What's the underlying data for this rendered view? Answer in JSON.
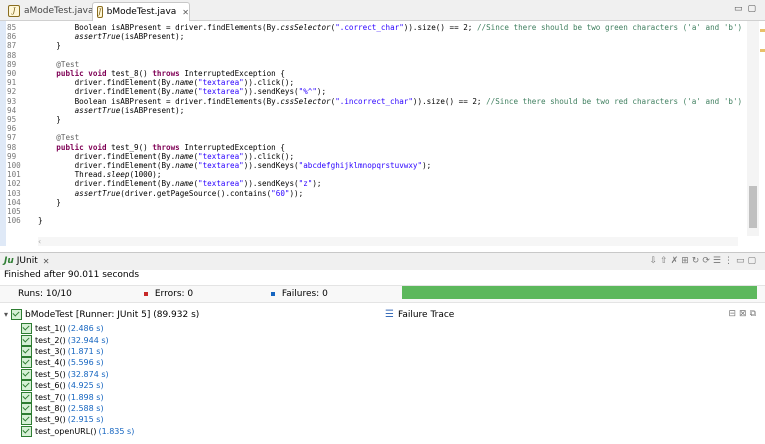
{
  "editor_tabs": [
    {
      "label": "aModeTest.java"
    },
    {
      "label": "bModeTest.java"
    }
  ],
  "code_lines": [
    {
      "num": "85",
      "parts": [
        {
          "t": "        Boolean "
        },
        {
          "t": "isABPresent",
          "c": "plain"
        },
        {
          "t": " = driver.findElements(By."
        },
        {
          "t": "cssSelector",
          "c": "it"
        },
        {
          "t": "("
        },
        {
          "t": "\".correct_char\"",
          "c": "str"
        },
        {
          "t": ")).size() == 2; "
        },
        {
          "t": "//Since there should be two green characters ('a' and 'b')",
          "c": "cm"
        }
      ]
    },
    {
      "num": "86",
      "parts": [
        {
          "t": "        "
        },
        {
          "t": "assertTrue",
          "c": "it"
        },
        {
          "t": "(isABPresent);"
        }
      ]
    },
    {
      "num": "87",
      "parts": [
        {
          "t": "    }"
        }
      ]
    },
    {
      "num": "88",
      "parts": [
        {
          "t": ""
        }
      ]
    },
    {
      "num": "89",
      "parts": [
        {
          "t": "    "
        },
        {
          "t": "@Test",
          "c": "an"
        }
      ]
    },
    {
      "num": "90",
      "parts": [
        {
          "t": "    "
        },
        {
          "t": "public void",
          "c": "kw"
        },
        {
          "t": " test_8() "
        },
        {
          "t": "throws",
          "c": "kw"
        },
        {
          "t": " InterruptedException {"
        }
      ]
    },
    {
      "num": "91",
      "parts": [
        {
          "t": "        driver.findElement(By."
        },
        {
          "t": "name",
          "c": "it"
        },
        {
          "t": "("
        },
        {
          "t": "\"textarea\"",
          "c": "str"
        },
        {
          "t": ")).click();"
        }
      ]
    },
    {
      "num": "92",
      "parts": [
        {
          "t": "        driver.findElement(By."
        },
        {
          "t": "name",
          "c": "it"
        },
        {
          "t": "("
        },
        {
          "t": "\"textarea\"",
          "c": "str"
        },
        {
          "t": ")).sendKeys("
        },
        {
          "t": "\"%^\"",
          "c": "str"
        },
        {
          "t": ");"
        }
      ]
    },
    {
      "num": "93",
      "parts": [
        {
          "t": "        Boolean isABPresent = driver.findElements(By."
        },
        {
          "t": "cssSelector",
          "c": "it"
        },
        {
          "t": "("
        },
        {
          "t": "\".incorrect_char\"",
          "c": "str"
        },
        {
          "t": ")).size() == 2; "
        },
        {
          "t": "//Since there should be two red characters ('a' and 'b')",
          "c": "cm"
        }
      ]
    },
    {
      "num": "94",
      "parts": [
        {
          "t": "        "
        },
        {
          "t": "assertTrue",
          "c": "it"
        },
        {
          "t": "(isABPresent);"
        }
      ]
    },
    {
      "num": "95",
      "parts": [
        {
          "t": "    }"
        }
      ]
    },
    {
      "num": "96",
      "parts": [
        {
          "t": ""
        }
      ]
    },
    {
      "num": "97",
      "parts": [
        {
          "t": "    "
        },
        {
          "t": "@Test",
          "c": "an"
        }
      ]
    },
    {
      "num": "98",
      "parts": [
        {
          "t": "    "
        },
        {
          "t": "public void",
          "c": "kw"
        },
        {
          "t": " test_9() "
        },
        {
          "t": "throws",
          "c": "kw"
        },
        {
          "t": " InterruptedException {"
        }
      ]
    },
    {
      "num": "99",
      "parts": [
        {
          "t": "        driver.findElement(By."
        },
        {
          "t": "name",
          "c": "it"
        },
        {
          "t": "("
        },
        {
          "t": "\"textarea\"",
          "c": "str"
        },
        {
          "t": ")).click();"
        }
      ]
    },
    {
      "num": "100",
      "parts": [
        {
          "t": "        driver.findElement(By."
        },
        {
          "t": "name",
          "c": "it"
        },
        {
          "t": "("
        },
        {
          "t": "\"textarea\"",
          "c": "str"
        },
        {
          "t": ")).sendKeys("
        },
        {
          "t": "\"abcdefghijklmnopqrstuvwxy\"",
          "c": "str"
        },
        {
          "t": ");"
        }
      ]
    },
    {
      "num": "101",
      "parts": [
        {
          "t": "        Thread."
        },
        {
          "t": "sleep",
          "c": "it"
        },
        {
          "t": "(1000);"
        }
      ]
    },
    {
      "num": "102",
      "parts": [
        {
          "t": "        driver.findElement(By."
        },
        {
          "t": "name",
          "c": "it"
        },
        {
          "t": "("
        },
        {
          "t": "\"textarea\"",
          "c": "str"
        },
        {
          "t": ")).sendKeys("
        },
        {
          "t": "\"z\"",
          "c": "str"
        },
        {
          "t": ");"
        }
      ]
    },
    {
      "num": "103",
      "parts": [
        {
          "t": "        "
        },
        {
          "t": "assertTrue",
          "c": "it"
        },
        {
          "t": "(driver.getPageSource().contains("
        },
        {
          "t": "\"60\"",
          "c": "str"
        },
        {
          "t": "));"
        }
      ]
    },
    {
      "num": "104",
      "parts": [
        {
          "t": "    }"
        }
      ]
    },
    {
      "num": "105",
      "parts": [
        {
          "t": ""
        }
      ]
    },
    {
      "num": "106",
      "parts": [
        {
          "t": "}"
        }
      ]
    }
  ],
  "junit": {
    "tab_label": "JUnit",
    "finished_text": "Finished after 90.011 seconds",
    "runs_label": "Runs:",
    "runs_value": "10/10",
    "errors_label": "Errors:",
    "errors_value": "0",
    "failures_label": "Failures:",
    "failures_value": "0",
    "progress_fraction": 1.0,
    "progress_color": "#5cb85c",
    "root_label": "bModeTest [Runner: JUnit 5] (89.932 s)",
    "tests": [
      {
        "name": "test_1()",
        "time": "(2.486 s)"
      },
      {
        "name": "test_2()",
        "time": "(32.944 s)"
      },
      {
        "name": "test_3()",
        "time": "(1.871 s)"
      },
      {
        "name": "test_4()",
        "time": "(5.596 s)"
      },
      {
        "name": "test_5()",
        "time": "(32.874 s)"
      },
      {
        "name": "test_6()",
        "time": "(4.925 s)"
      },
      {
        "name": "test_7()",
        "time": "(1.898 s)"
      },
      {
        "name": "test_8()",
        "time": "(2.588 s)"
      },
      {
        "name": "test_9()",
        "time": "(2.915 s)"
      },
      {
        "name": "test_openURL()",
        "time": "(1.835 s)"
      }
    ],
    "failure_trace_label": "Failure Trace"
  }
}
